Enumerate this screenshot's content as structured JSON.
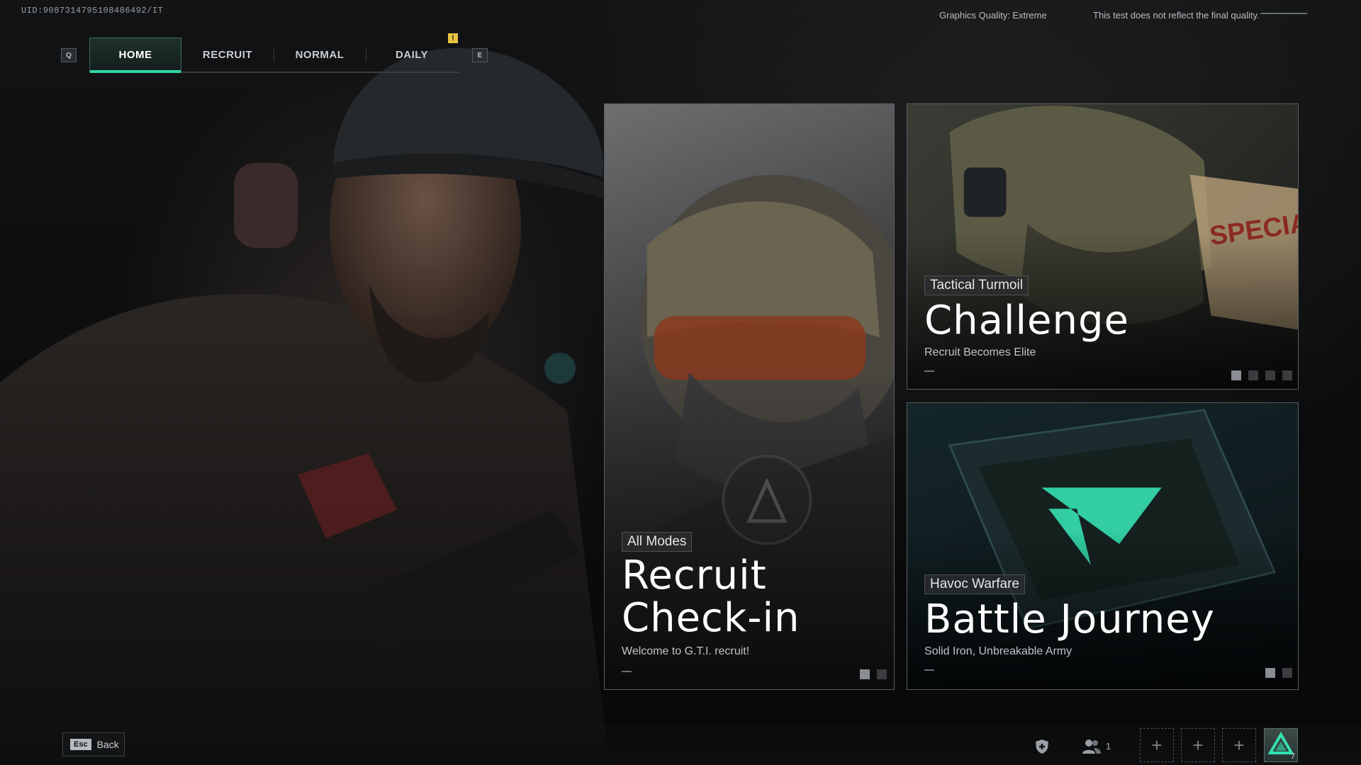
{
  "uid": "UID:9087314795108486492/IT",
  "top_right": {
    "graphics_quality": "Graphics Quality: Extreme",
    "disclaimer": "This test does not reflect the final quality."
  },
  "tabs": {
    "left_key": "Q",
    "right_key": "E",
    "items": [
      {
        "label": "HOME",
        "active": true
      },
      {
        "label": "RECRUIT",
        "active": false
      },
      {
        "label": "NORMAL",
        "active": false
      },
      {
        "label": "DAILY",
        "active": false
      }
    ],
    "alert_glyph": "!"
  },
  "cards": {
    "recruit": {
      "tag": "All Modes",
      "title_line1": "Recruit",
      "title_line2": "Check-in",
      "subtitle": "Welcome to G.T.I. recruit!"
    },
    "challenge": {
      "tag": "Tactical Turmoil",
      "title": "Challenge",
      "subtitle": "Recruit Becomes Elite"
    },
    "battle": {
      "tag": "Havoc Warfare",
      "title": "Battle Journey",
      "subtitle": "Solid Iron, Unbreakable Army"
    }
  },
  "bottom": {
    "esc_key": "Esc",
    "esc_label": "Back",
    "party_count": "1",
    "slot_glyph": "+",
    "rank_level": "7"
  },
  "colors": {
    "accent": "#2fd8a8",
    "tab_alert": "#e7c441"
  }
}
